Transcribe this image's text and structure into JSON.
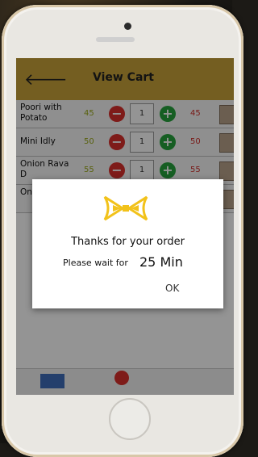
{
  "app": {
    "title": "View Cart"
  },
  "cart": {
    "items": [
      {
        "name": "Poori with Potato",
        "price": "45",
        "qty": "1",
        "total": "45"
      },
      {
        "name": "Mini Idly",
        "price": "50",
        "qty": "1",
        "total": "50"
      },
      {
        "name": "Onion Rava D",
        "price": "55",
        "qty": "1",
        "total": "55"
      },
      {
        "name": "On Ra",
        "price": "",
        "qty": "",
        "total": ""
      }
    ],
    "minus_symbol": "−",
    "plus_symbol": "+"
  },
  "dialog": {
    "message": "Thanks for your order",
    "wait_label": "Please wait for",
    "wait_time": "25 Min",
    "ok_label": "OK"
  },
  "colors": {
    "appbar": "#c8a339",
    "minus": "#d9302c",
    "plus": "#27a33d",
    "price": "#9aa91a",
    "total": "#d0312d",
    "logo": "#f2c21a"
  },
  "icons": {
    "back": "arrow-left-icon",
    "calendar": "calendar-icon",
    "mail": "mail-icon",
    "logo": "bowtie-logo-icon"
  }
}
